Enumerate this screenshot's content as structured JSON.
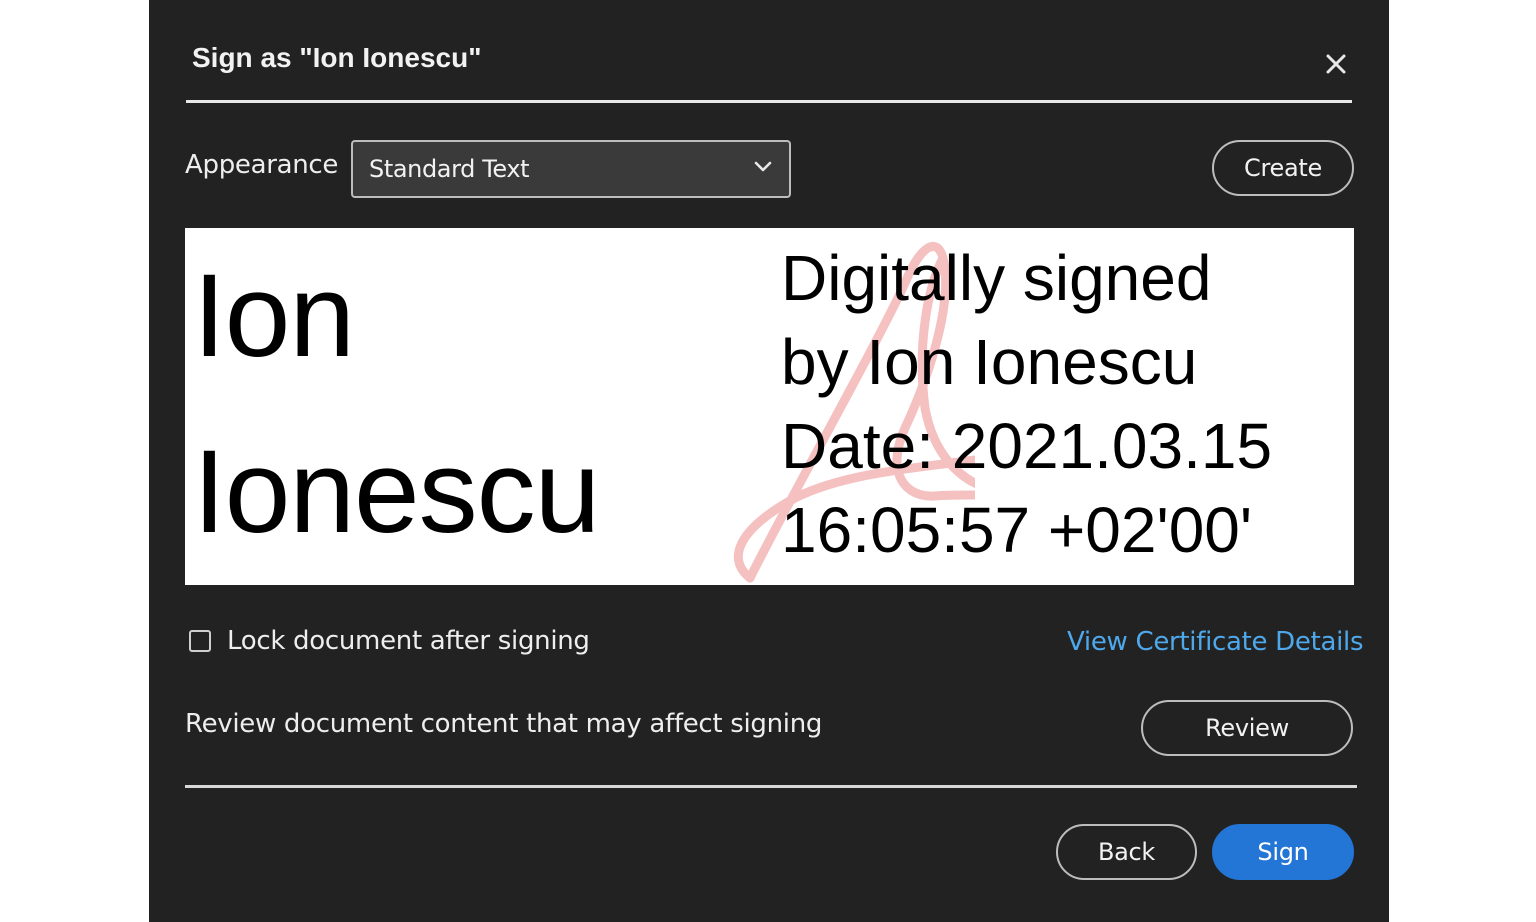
{
  "dialog": {
    "title": "Sign as \"Ion Ionescu\"",
    "close_icon": "close-icon"
  },
  "appearance": {
    "label": "Appearance",
    "selected": "Standard Text",
    "chevron_icon": "chevron-down-icon",
    "create_label": "Create"
  },
  "preview": {
    "name_lines": [
      "Ion",
      "Ionescu"
    ],
    "detail_lines": [
      "Digitally signed",
      "by Ion Ionescu",
      "Date: 2021.03.15",
      "16:05:57 +02'00'"
    ],
    "watermark_icon": "acrobat-logo-watermark",
    "watermark_color": "#f4b6b6"
  },
  "options": {
    "lock_label": "Lock document after signing",
    "lock_checked": false,
    "cert_link": "View Certificate Details",
    "review_text": "Review document content that may affect signing",
    "review_label": "Review"
  },
  "footer": {
    "back_label": "Back",
    "sign_label": "Sign"
  },
  "colors": {
    "dialog_bg": "#222222",
    "accent": "#2375d6",
    "link": "#4ea8ec"
  }
}
